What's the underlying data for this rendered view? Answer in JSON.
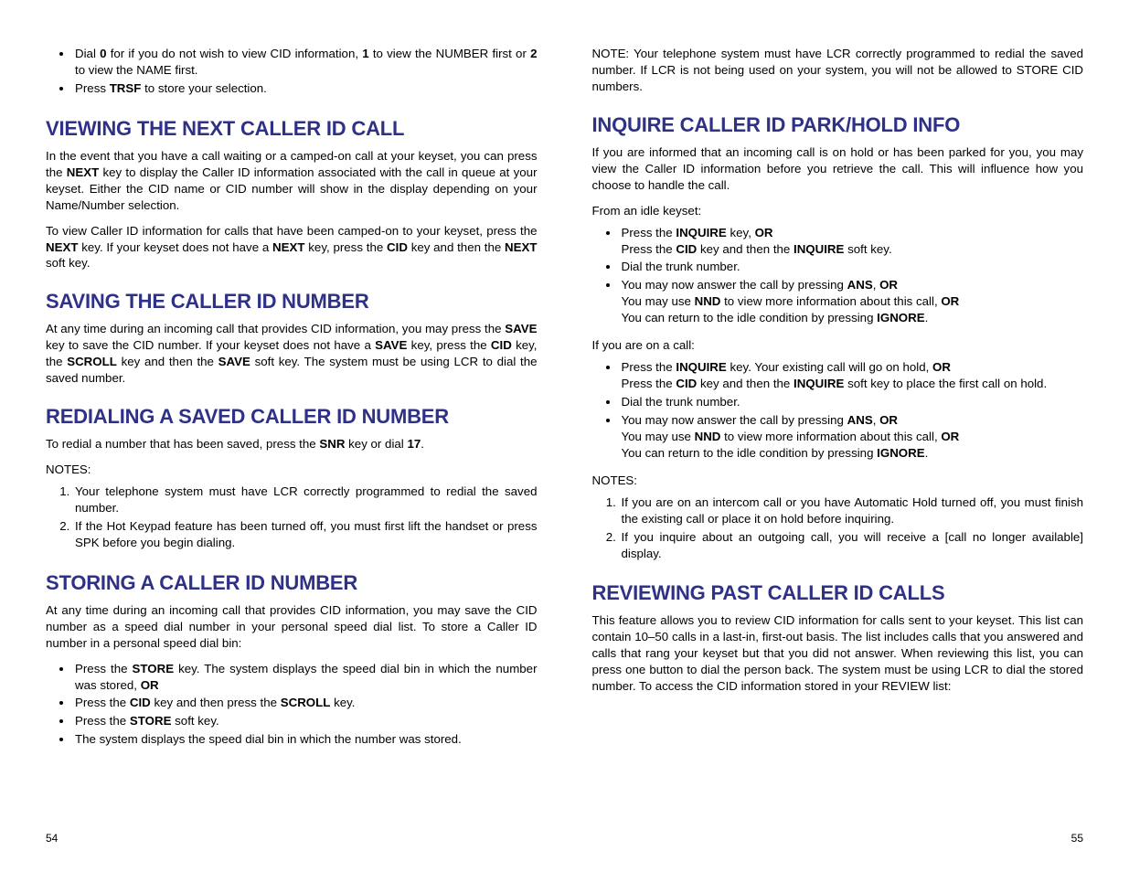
{
  "left": {
    "intro_bullets": [
      "Dial <b>0</b> for if you do not wish to view CID information, <b>1</b> to view the NUMBER first or <b>2</b> to view the NAME first.",
      "Press <b>TRSF</b> to store your selection."
    ],
    "h_viewing": "VIEWING THE NEXT CALLER ID CALL",
    "viewing_p1": "In the event that you have a call waiting or a camped-on call at your keyset, you can press the <b>NEXT</b> key to display the Caller ID information associated with the call in queue at your keyset. Either the CID name or CID number will show in the display depending on your Name/Number selection.",
    "viewing_p2": "To view Caller ID information for calls that have been camped-on to your keyset, press the <b>NEXT</b> key. If your keyset does not have a <b>NEXT</b> key, press the <b>CID</b> key and then the <b>NEXT</b> soft key.",
    "h_saving": "SAVING THE CALLER ID NUMBER",
    "saving_p1": "At any time during an incoming call that provides CID information, you may press the <b>SAVE</b> key to save the CID number. If your keyset does not have a <b>SAVE</b> key, press the <b>CID</b> key, the  <b>SCROLL</b> key and then the <b>SAVE</b> soft key. The system must be using LCR to dial the saved number.",
    "h_redialing": "REDIALING A SAVED CALLER ID NUMBER",
    "redialing_p1": "To redial a number that has been saved, press the <b>SNR</b> key or dial <b>17</b>.",
    "notes_label": "NOTES:",
    "redialing_notes": [
      "Your telephone system must have LCR correctly programmed to redial the saved number.",
      "If the Hot Keypad feature has been turned off, you must first lift the handset or press SPK before you begin dialing."
    ],
    "h_storing": "STORING A CALLER ID NUMBER",
    "storing_p1": "At any time during an incoming call that provides CID information, you may save the CID number as a speed dial number in your personal speed dial list. To store a Caller ID number in a personal speed dial bin:",
    "storing_bullets": [
      "Press the <b>STORE</b> key. The system displays the speed dial bin in which the number was stored, <b>OR</b>",
      "Press the <b>CID</b> key and then press the <b>SCROLL</b> key.",
      "Press the <b>STORE</b> soft key.",
      "The system displays the speed dial bin in which the number was stored."
    ],
    "page": "54"
  },
  "right": {
    "note_top": "NOTE: Your telephone system must have LCR correctly programmed to redial the saved number. If LCR is not being used on your system, you will not be allowed to STORE CID numbers.",
    "h_inquire": "INQUIRE CALLER ID PARK/HOLD INFO",
    "inquire_p1": "If you are informed that an incoming call is on hold or has been parked for you, you may view the Caller ID information before you retrieve the call. This will influence how you choose to handle the call.",
    "idle_label": "From an idle keyset:",
    "idle_bullets": [
      "Press the <b>INQUIRE</b> key, <b>OR</b><br>Press the <b>CID</b> key and then the <b>INQUIRE</b> soft key.",
      "Dial the trunk number.",
      "You may now answer the call by pressing <b>ANS</b>, <b>OR</b><br>You may use <b>NND</b> to view more information about this call, <b>OR</b><br>You can return to the idle condition by pressing <b>IGNORE</b>."
    ],
    "oncall_label": "If you are on a call:",
    "oncall_bullets": [
      "Press the <b>INQUIRE</b> key. Your existing call will go on hold, <b>OR</b><br>Press the <b>CID</b> key and then the <b>INQUIRE</b> soft key to place the first call on hold.",
      "Dial the trunk number.",
      "You may now answer the call by pressing <b>ANS</b>, <b>OR</b><br>You may use <b>NND</b> to view more information about this call, <b>OR</b><br>You can return to the idle condition by pressing <b>IGNORE</b>."
    ],
    "notes_label": "NOTES:",
    "inquire_notes": [
      "If you are on an intercom call or you have Automatic Hold turned off, you must finish the existing call or place it on hold before inquiring.",
      "If you inquire about an outgoing call, you will receive a [call no longer available] display."
    ],
    "h_reviewing": "REVIEWING PAST CALLER ID CALLS",
    "reviewing_p1": "This feature allows you to review CID information for calls sent to your keyset. This list can contain 10–50 calls in a last-in, first-out basis. The list includes calls that you answered and calls that rang your keyset but that you did not answer. When reviewing this list, you can press one button to dial the person back. The system must be using LCR to dial the stored number. To access the CID information stored in your REVIEW list:",
    "page": "55"
  }
}
